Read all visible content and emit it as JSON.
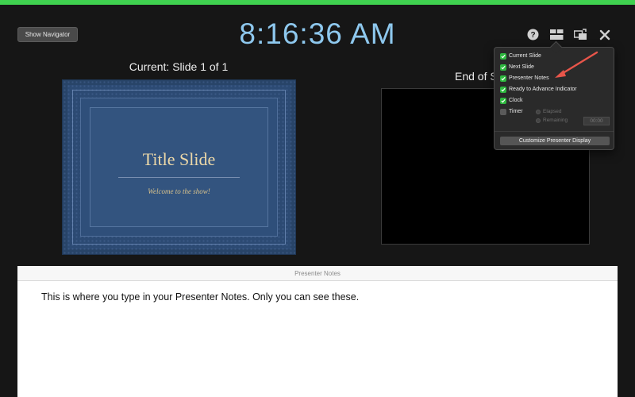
{
  "status": {
    "ready_color": "#3fd14f"
  },
  "toolbar": {
    "show_navigator_label": "Show Navigator",
    "clock": "8:16:36 AM",
    "icons": [
      "help-icon",
      "layout-icon",
      "swap-displays-icon",
      "close-icon"
    ]
  },
  "current": {
    "label": "Current: Slide 1 of 1",
    "slide_title": "Title Slide",
    "slide_subtitle": "Welcome to the show!"
  },
  "next": {
    "label": "End of S"
  },
  "layout_menu": {
    "options": [
      {
        "label": "Current Slide",
        "checked": true
      },
      {
        "label": "Next Slide",
        "checked": true
      },
      {
        "label": "Presenter Notes",
        "checked": true
      },
      {
        "label": "Ready to Advance Indicator",
        "checked": true
      },
      {
        "label": "Clock",
        "checked": true
      },
      {
        "label": "Timer",
        "checked": false
      }
    ],
    "timer_modes": [
      "Elapsed",
      "Remaining"
    ],
    "timer_value": "00:00",
    "customize_label": "Customize Presenter Display"
  },
  "notes": {
    "header": "Presenter Notes",
    "text": "This is where you type in your Presenter Notes. Only you can see these."
  }
}
